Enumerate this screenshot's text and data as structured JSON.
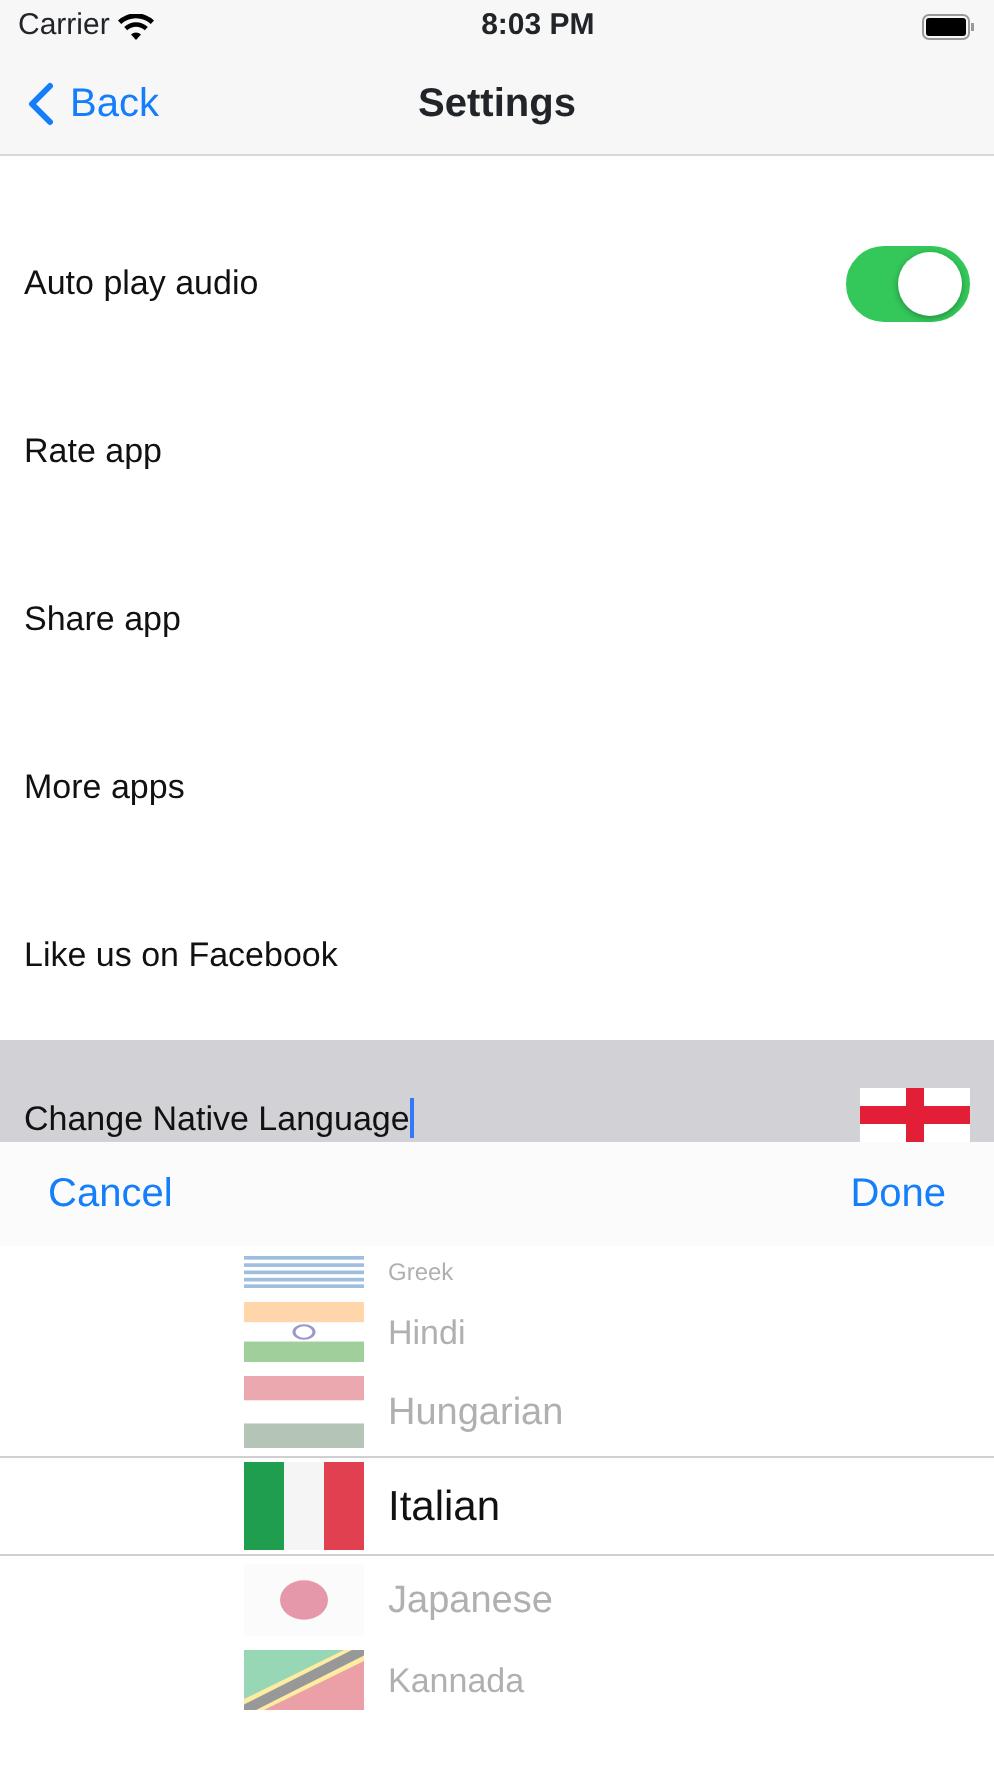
{
  "status_bar": {
    "carrier": "Carrier",
    "time": "8:03 PM"
  },
  "nav": {
    "back": "Back",
    "title": "Settings"
  },
  "settings": [
    {
      "kind": "toggle",
      "label": "Auto play audio",
      "on": true
    },
    {
      "kind": "link",
      "label": "Rate app"
    },
    {
      "kind": "link",
      "label": "Share app"
    },
    {
      "kind": "link",
      "label": "More apps"
    },
    {
      "kind": "link",
      "label": "Like us on Facebook"
    },
    {
      "kind": "language",
      "label": "Change Native Language",
      "selected": true
    }
  ],
  "toolbar": {
    "cancel": "Cancel",
    "done": "Done"
  },
  "picker": [
    {
      "label": "Greek",
      "selected": false
    },
    {
      "label": "Hindi",
      "selected": false
    },
    {
      "label": "Hungarian",
      "selected": false
    },
    {
      "label": "Italian",
      "selected": true
    },
    {
      "label": "Japanese",
      "selected": false
    },
    {
      "label": "Kannada",
      "selected": false
    }
  ]
}
